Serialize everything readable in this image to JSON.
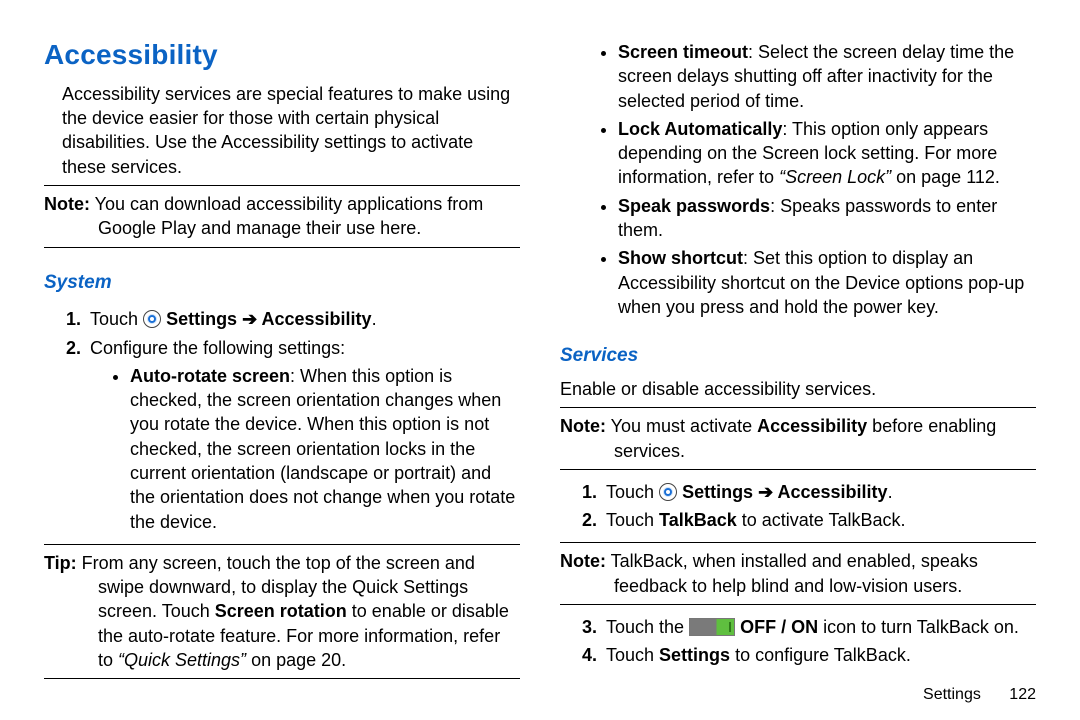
{
  "heading": "Accessibility",
  "intro": "Accessibility services are special features to make using the device easier for those with certain physical disabilities. Use the Accessibility settings to activate these services.",
  "note1_lead": "Note:",
  "note1_body": " You can download accessibility applications from Google Play and manage their use here.",
  "system_heading": "System",
  "step1_pre": "Touch ",
  "step_settings_path": " Settings ",
  "arrow": "➔",
  "step_acc": " Accessibility",
  "period": ".",
  "step2": "Configure the following settings:",
  "auto_rotate_label": "Auto-rotate screen",
  "auto_rotate_body": ": When this option is checked, the screen orientation changes when you rotate the device. When this option is not checked, the screen orientation locks in the current orientation (landscape or portrait) and the orientation does not change when you rotate the device.",
  "tip_lead": "Tip:",
  "tip_b1": " From any screen, touch the top of the screen and swipe downward, to display the Quick Settings screen. Touch ",
  "tip_bold": "Screen rotation",
  "tip_b2": " to enable or disable the auto-rotate feature. For more information, refer to ",
  "tip_ref": "“Quick Settings”",
  "tip_b3": " on page 20.",
  "screen_timeout_label": "Screen timeout",
  "screen_timeout_body": ": Select the screen delay time the screen delays shutting off after inactivity for the selected period of time.",
  "lock_auto_label": "Lock Automatically",
  "lock_auto_b1": ": This option only appears depending on the Screen lock setting. For more information, refer to ",
  "lock_auto_ref": "“Screen Lock”",
  "lock_auto_b2": " on page 112.",
  "speak_pw_label": "Speak passwords",
  "speak_pw_body": ": Speaks passwords to enter them.",
  "show_shortcut_label": "Show shortcut",
  "show_shortcut_body": ": Set this option to display an Accessibility shortcut on the Device options pop-up when you press and hold the power key.",
  "services_heading": "Services",
  "services_intro": "Enable or disable accessibility services.",
  "note2_lead": "Note:",
  "note2_b1": " You must activate ",
  "note2_bold": "Accessibility",
  "note2_b2": " before enabling services.",
  "talkback_pre": "Touch ",
  "talkback_bold": "TalkBack",
  "talkback_post": " to activate TalkBack.",
  "note3_lead": "Note:",
  "note3_body": " TalkBack, when installed and enabled, speaks feedback to help blind and low-vision users.",
  "step3_pre": "Touch the ",
  "offon": " OFF / ON",
  "step3_post": " icon to turn TalkBack on.",
  "step4_pre": "Touch ",
  "step4_bold": "Settings",
  "step4_post": " to configure TalkBack.",
  "footer_section": "Settings",
  "footer_page": "122"
}
